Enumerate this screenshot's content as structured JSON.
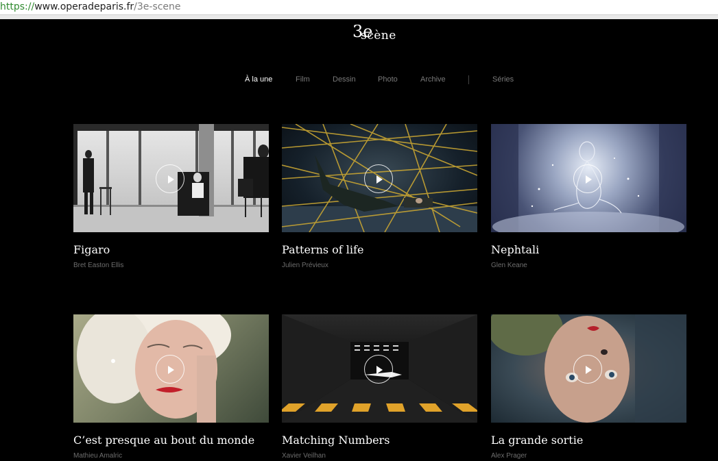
{
  "browser": {
    "url_scheme": "https://",
    "url_host": "www.operadeparis.fr",
    "url_path": "/3e-scene"
  },
  "logo": {
    "number": "3e",
    "word": "scène"
  },
  "nav": {
    "items": [
      {
        "label": "À la une",
        "active": true
      },
      {
        "label": "Film",
        "active": false
      },
      {
        "label": "Dessin",
        "active": false
      },
      {
        "label": "Photo",
        "active": false
      },
      {
        "label": "Archive",
        "active": false
      },
      {
        "label": "Séries",
        "active": false
      }
    ]
  },
  "videos": [
    {
      "title": "Figaro",
      "author": "Bret Easton Ellis"
    },
    {
      "title": "Patterns of life",
      "author": "Julien Prévieux"
    },
    {
      "title": "Nephtali",
      "author": "Glen Keane"
    },
    {
      "title": "C’est presque au bout du monde",
      "author": "Mathieu Amalric"
    },
    {
      "title": "Matching Numbers",
      "author": "Xavier Veilhan"
    },
    {
      "title": "La grande sortie",
      "author": "Alex Prager"
    }
  ],
  "icons": {
    "play": "play-icon"
  }
}
